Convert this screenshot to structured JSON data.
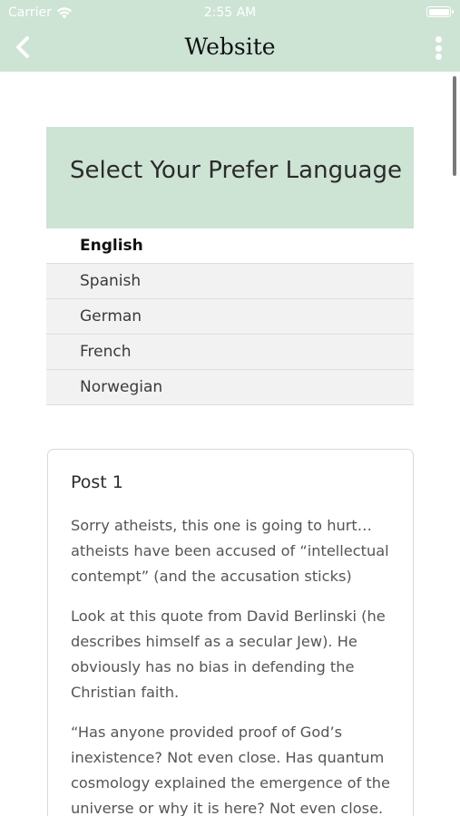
{
  "status_bar": {
    "carrier": "Carrier",
    "time": "2:55 AM"
  },
  "navbar": {
    "title": "Website",
    "back_icon": "chevron-left-icon",
    "more_icon": "more-vertical-icon"
  },
  "language_panel": {
    "title": "Select Your Prefer Language",
    "options": [
      {
        "label": "English",
        "selected": true
      },
      {
        "label": "Spanish",
        "selected": false
      },
      {
        "label": "German",
        "selected": false
      },
      {
        "label": "French",
        "selected": false
      },
      {
        "label": "Norwegian",
        "selected": false
      }
    ]
  },
  "post": {
    "title": "Post 1",
    "paragraphs": [
      "Sorry atheists, this one is going to hurt… atheists have been accused of “intellectual contempt” (and the accusation sticks)",
      "Look at this quote from David Berlinski (he describes himself as a secular Jew). He obviously has no bias in defending the Christian faith.",
      "“Has anyone provided proof of God’s inexistence? Not even close. Has quantum cosmology explained the emergence of the universe or why it is here? Not even close."
    ]
  },
  "colors": {
    "header_bg": "#cde3d4",
    "selected_bg": "#ffffff",
    "option_bg": "#f2f2f2"
  }
}
